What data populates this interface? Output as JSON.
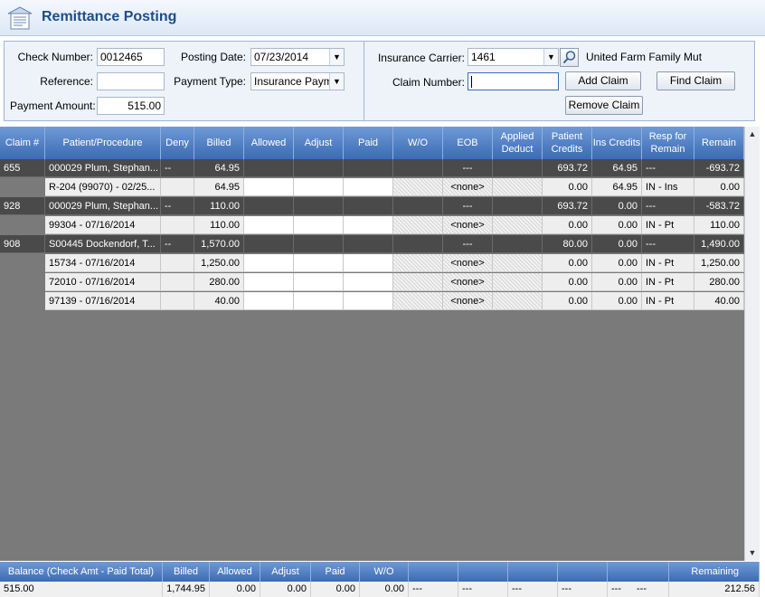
{
  "title": "Remittance Posting",
  "form": {
    "check_number_label": "Check Number:",
    "check_number_value": "0012465",
    "reference_label": "Reference:",
    "reference_value": "",
    "payment_amount_label": "Payment Amount:",
    "payment_amount_value": "515.00",
    "posting_date_label": "Posting Date:",
    "posting_date_value": "07/23/2014",
    "payment_type_label": "Payment Type:",
    "payment_type_value": "Insurance Payme",
    "insurance_carrier_label": "Insurance Carrier:",
    "insurance_carrier_value": "1461",
    "insurance_carrier_name": "United Farm Family Mut",
    "claim_number_label": "Claim Number:",
    "claim_number_value": "",
    "add_claim_label": "Add Claim",
    "find_claim_label": "Find Claim",
    "remove_claim_label": "Remove Claim"
  },
  "grid": {
    "headers": [
      "Claim #",
      "Patient/Procedure",
      "Deny",
      "Billed",
      "Allowed",
      "Adjust",
      "Paid",
      "W/O",
      "EOB",
      "Applied Deduct",
      "Patient Credits",
      "Ins Credits",
      "Resp for Remain",
      "Remain"
    ],
    "rows": [
      {
        "type": "claim",
        "cells": [
          "655",
          "000029 Plum, Stephan...",
          "--",
          "64.95",
          "",
          "",
          "",
          "",
          "---",
          "",
          "693.72",
          "64.95",
          "---",
          "-693.72"
        ]
      },
      {
        "type": "proc",
        "cells": [
          "",
          "R-204 (99070) - 02/25...",
          "",
          "64.95",
          "",
          "",
          "",
          "",
          "<none>",
          "",
          "0.00",
          "64.95",
          "IN - Ins",
          "0.00"
        ]
      },
      {
        "type": "claim",
        "cells": [
          "928",
          "000029 Plum, Stephan...",
          "--",
          "110.00",
          "",
          "",
          "",
          "",
          "---",
          "",
          "693.72",
          "0.00",
          "---",
          "-583.72"
        ]
      },
      {
        "type": "proc",
        "cells": [
          "",
          "99304 - 07/16/2014",
          "",
          "110.00",
          "",
          "",
          "",
          "",
          "<none>",
          "",
          "0.00",
          "0.00",
          "IN - Pt",
          "110.00"
        ]
      },
      {
        "type": "claim",
        "cells": [
          "908",
          "S00445 Dockendorf, T...",
          "--",
          "1,570.00",
          "",
          "",
          "",
          "",
          "---",
          "",
          "80.00",
          "0.00",
          "---",
          "1,490.00"
        ]
      },
      {
        "type": "proc",
        "cells": [
          "",
          "15734 - 07/16/2014",
          "",
          "1,250.00",
          "",
          "",
          "",
          "",
          "<none>",
          "",
          "0.00",
          "0.00",
          "IN - Pt",
          "1,250.00"
        ]
      },
      {
        "type": "proc",
        "cells": [
          "",
          "72010 - 07/16/2014",
          "",
          "280.00",
          "",
          "",
          "",
          "",
          "<none>",
          "",
          "0.00",
          "0.00",
          "IN - Pt",
          "280.00"
        ]
      },
      {
        "type": "proc",
        "cells": [
          "",
          "97139 - 07/16/2014",
          "",
          "40.00",
          "",
          "",
          "",
          "",
          "<none>",
          "",
          "0.00",
          "0.00",
          "IN - Pt",
          "40.00"
        ]
      }
    ]
  },
  "footer": {
    "headers": [
      "Balance (Check Amt - Paid Total)",
      "Billed",
      "Allowed",
      "Adjust",
      "Paid",
      "W/O",
      "",
      "",
      "",
      "",
      "",
      "",
      "Remaining"
    ],
    "values": [
      "515.00",
      "1,744.95",
      "0.00",
      "0.00",
      "0.00",
      "0.00",
      "---",
      "---",
      "---",
      "---",
      "---",
      "---",
      "212.56"
    ]
  },
  "colors": {
    "header_blue": "#3c6bb5",
    "title_blue": "#1d4d8a",
    "claim_row": "#4a4a4a",
    "grid_background": "#7a7a7a"
  }
}
